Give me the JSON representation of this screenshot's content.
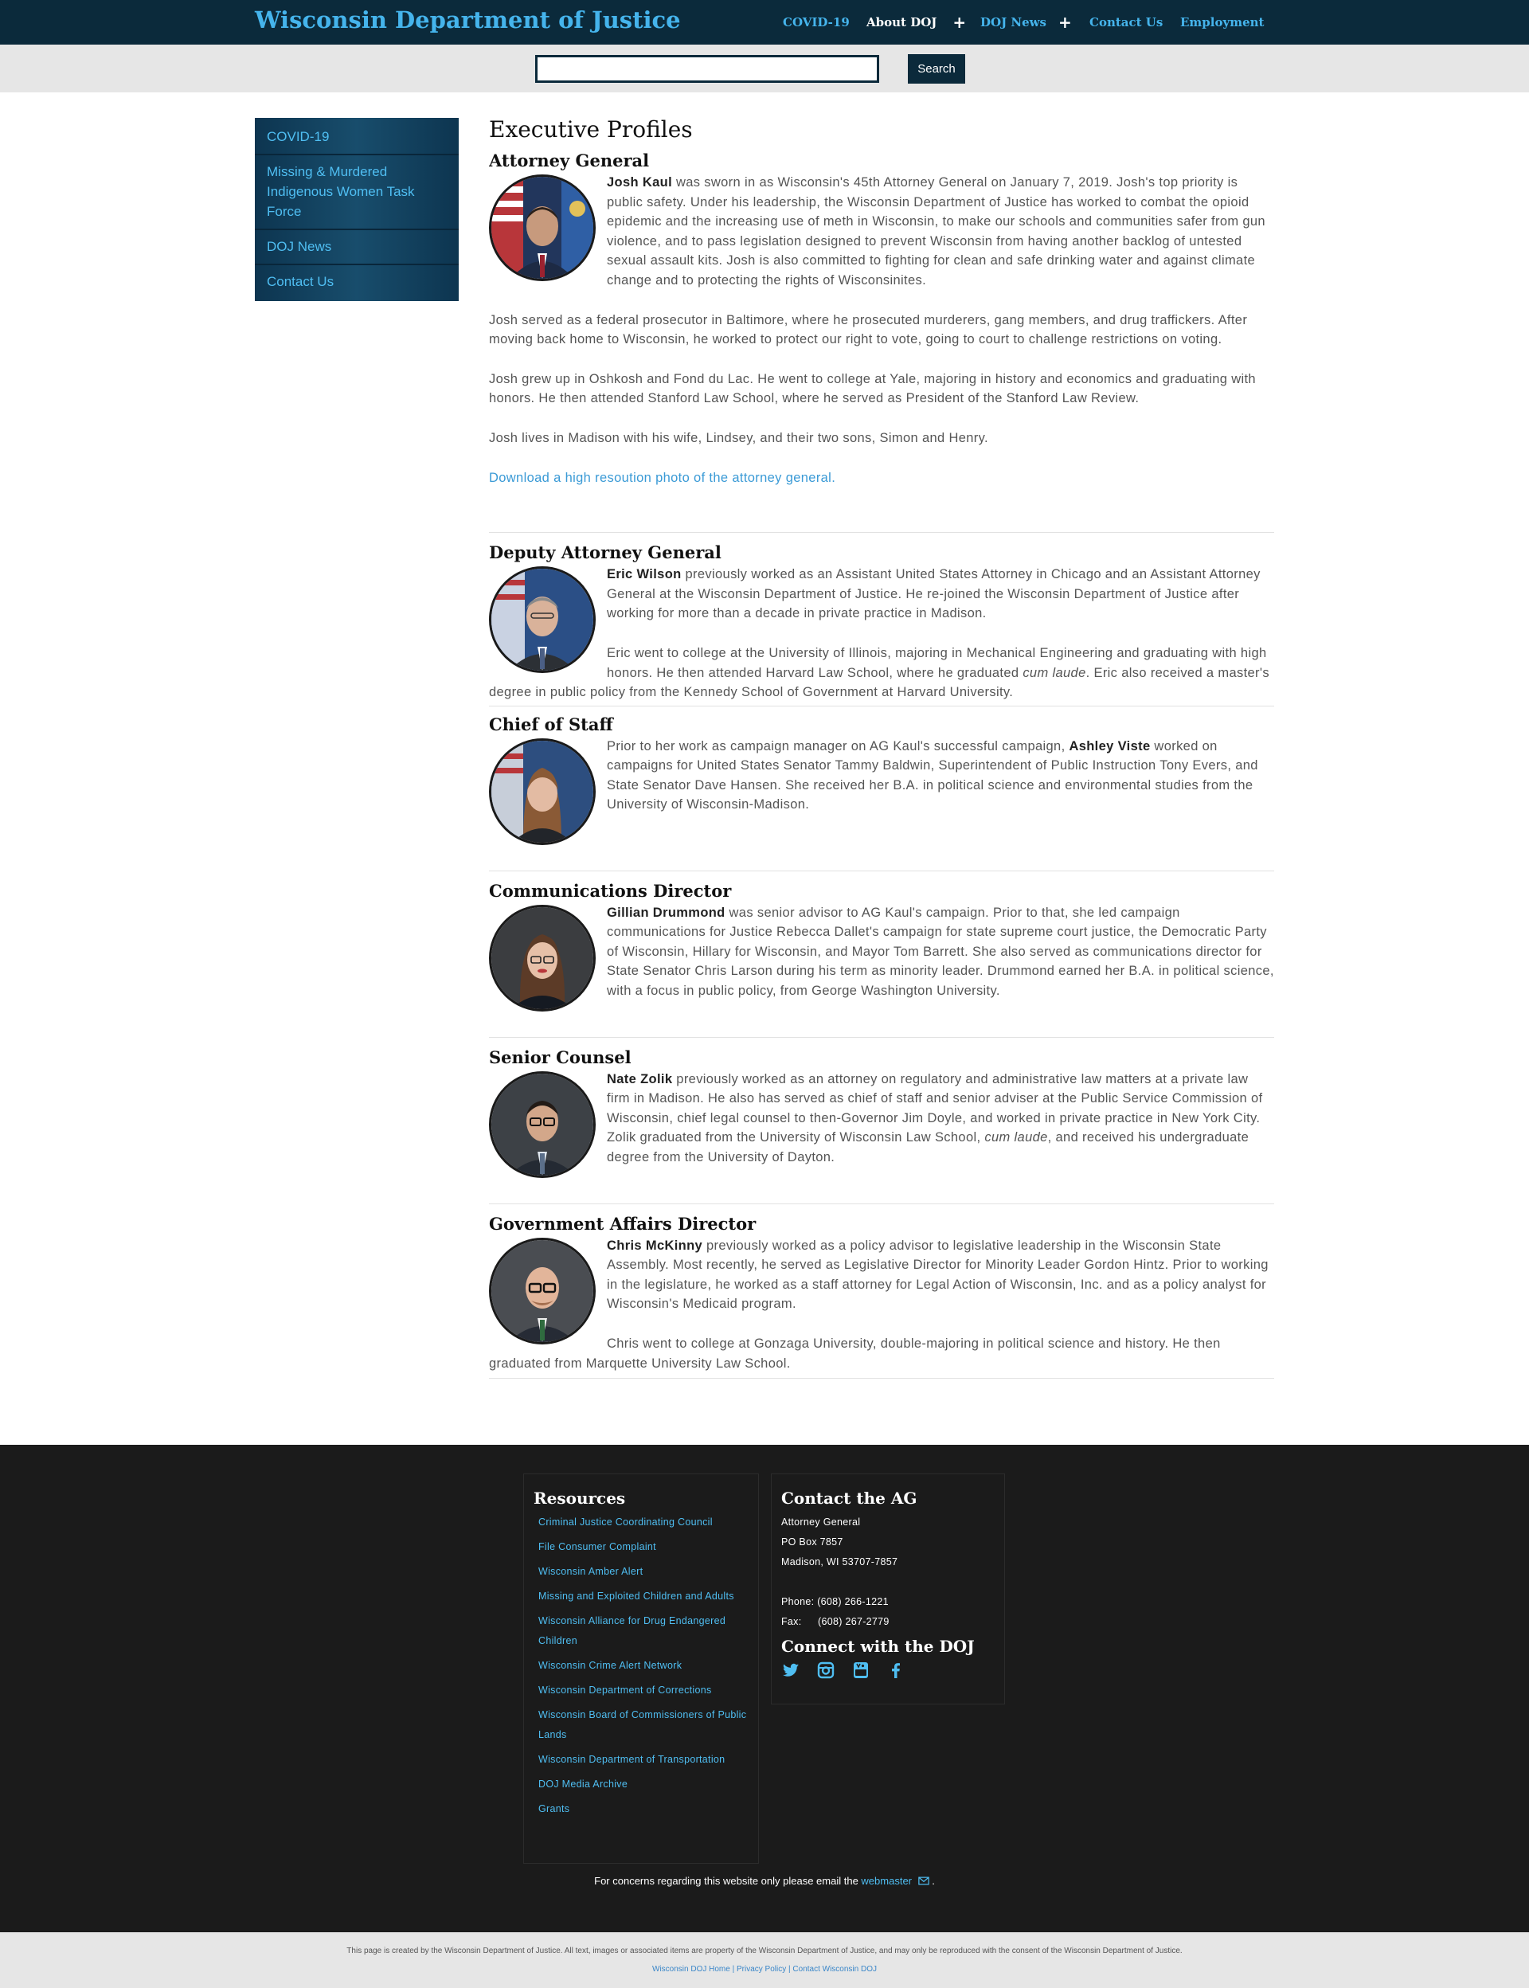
{
  "header": {
    "site_title": "Wisconsin Department of Justice",
    "nav": [
      {
        "label": "COVID-19",
        "has_plus": false,
        "active": false
      },
      {
        "label": "About DOJ",
        "has_plus": true,
        "active": true
      },
      {
        "label": "DOJ News",
        "has_plus": true,
        "active": false
      },
      {
        "label": "Contact Us",
        "has_plus": false,
        "active": false
      },
      {
        "label": "Employment",
        "has_plus": false,
        "active": false
      }
    ],
    "plus_glyph": "+"
  },
  "search": {
    "value": "",
    "button_label": "Search"
  },
  "sidebar": {
    "items": [
      {
        "label": "COVID-19"
      },
      {
        "label": "Missing & Murdered Indigenous Women Task Force"
      },
      {
        "label": "DOJ News"
      },
      {
        "label": "Contact Us"
      }
    ]
  },
  "main": {
    "title": "Executive Profiles",
    "ag": {
      "heading": "Attorney General",
      "name": "Josh Kaul",
      "p1_rest": " was sworn in as Wisconsin's 45th Attorney General on January 7, 2019. Josh's top priority is public safety. Under his leadership, the Wisconsin Department of Justice has worked to combat the opioid epidemic and the increasing use of meth in Wisconsin, to make our schools and communities safer from gun violence, and to pass legislation designed to prevent Wisconsin from having another backlog of untested sexual assault kits. Josh is also committed to fighting for clean and safe drinking water and against climate change and to protecting the rights of Wisconsinites.",
      "p2": "Josh served as a federal prosecutor in Baltimore, where he prosecuted murderers, gang members, and drug traffickers. After moving back home to Wisconsin, he worked to protect our right to vote, going to court to challenge restrictions on voting.",
      "p3": "Josh grew up in Oshkosh and Fond du Lac. He went to college at Yale, majoring in history and economics and graduating with honors. He then attended Stanford Law School, where he served as President of the Stanford Law Review.",
      "p4": "Josh lives in Madison with his wife, Lindsey, and their two sons, Simon and Henry.",
      "download_link": "Download a high resoution photo of the attorney general."
    },
    "deputy": {
      "heading": "Deputy Attorney General",
      "name": "Eric Wilson",
      "p1_rest": " previously worked as an Assistant United States Attorney in Chicago and an Assistant Attorney General at the Wisconsin Department of Justice. He re-joined the Wisconsin Department of Justice after working for more than a decade in private practice in Madison.",
      "p2_a": "Eric went to college at the University of Illinois, majoring in Mechanical Engineering and graduating with high honors. He then attended Harvard Law School, where he graduated ",
      "p2_em": "cum laude",
      "p2_b": ".  Eric also received a master's degree in public policy from the Kennedy School of Government at Harvard University."
    },
    "chief": {
      "heading": "Chief of Staff",
      "p1_a": "Prior to her work as campaign manager on AG Kaul's successful campaign, ",
      "name": "Ashley Viste",
      "p1_b": " worked on campaigns for United States Senator Tammy Baldwin, Superintendent of Public Instruction Tony Evers, and State Senator Dave Hansen. She received her B.A. in political science and environmental studies from the University of Wisconsin-Madison."
    },
    "comms": {
      "heading": "Communications Director",
      "name": "Gillian Drummond",
      "p1_rest": " was senior advisor to AG Kaul's campaign. Prior to that, she led campaign communications for Justice Rebecca Dallet's campaign for state supreme court justice, the Democratic Party of Wisconsin, Hillary for Wisconsin, and Mayor Tom Barrett. She also served as communications director for State Senator Chris Larson during his term as minority leader. Drummond earned her B.A. in political science, with a focus in public policy, from George Washington University."
    },
    "counsel": {
      "heading": "Senior Counsel",
      "name": "Nate Zolik",
      "p1_a": " previously worked as an attorney on regulatory and administrative law matters at a private law firm in Madison.  He also has served as chief of staff and senior adviser at the Public Service Commission of Wisconsin, chief legal counsel to then-Governor Jim Doyle, and worked in private practice in New York City.  Zolik graduated from the University of Wisconsin Law School, ",
      "p1_em": "cum laude",
      "p1_b": ", and received his undergraduate degree from the University of Dayton."
    },
    "gov": {
      "heading": "Government Affairs Director",
      "name": "Chris McKinny",
      "p1_rest": " previously worked as a policy advisor to legislative leadership in the Wisconsin State Assembly.  Most recently, he served as Legislative Director for Minority Leader Gordon Hintz.  Prior to working in the legislature, he worked as a staff attorney for Legal Action of Wisconsin, Inc.  and as a policy analyst for Wisconsin's Medicaid program.",
      "p2": "Chris went to college at Gonzaga University, double-majoring in political science and history.  He then graduated from Marquette University Law School."
    }
  },
  "footer": {
    "resources_title": "Resources",
    "resources": [
      "Criminal Justice Coordinating Council",
      "File Consumer Complaint",
      "Wisconsin Amber Alert",
      "Missing and Exploited Children and Adults",
      "Wisconsin Alliance for Drug Endangered Children",
      "Wisconsin Crime Alert Network",
      "Wisconsin Department of Corrections",
      "Wisconsin Board of Commissioners of Public Lands",
      "Wisconsin Department of Transportation",
      "DOJ Media Archive",
      "Grants"
    ],
    "contact_title": "Contact the AG",
    "address": [
      "Attorney General",
      "PO Box 7857",
      "Madison, WI 53707-7857"
    ],
    "phone": "Phone: (608) 266-1221",
    "fax_label": "Fax:",
    "fax_number": "(608) 267-2779",
    "connect_title": "Connect with the DOJ",
    "social_icons": [
      "twitter-icon",
      "instagram-icon",
      "youtube-icon",
      "facebook-icon"
    ],
    "concern_text": "For concerns regarding this website only please email the ",
    "webmaster_label": "webmaster",
    "concern_end": " .",
    "accent_color": "#4fbef2"
  },
  "bottom": {
    "legal": "This page is created by the Wisconsin Department of Justice. All text, images or associated items are property of the Wisconsin Department of Justice, and may only be reproduced with the consent of the Wisconsin Department of Justice.",
    "links": [
      "Wisconsin DOJ Home",
      "Privacy Policy",
      "Contact Wisconsin DOJ"
    ],
    "separator": "|"
  }
}
